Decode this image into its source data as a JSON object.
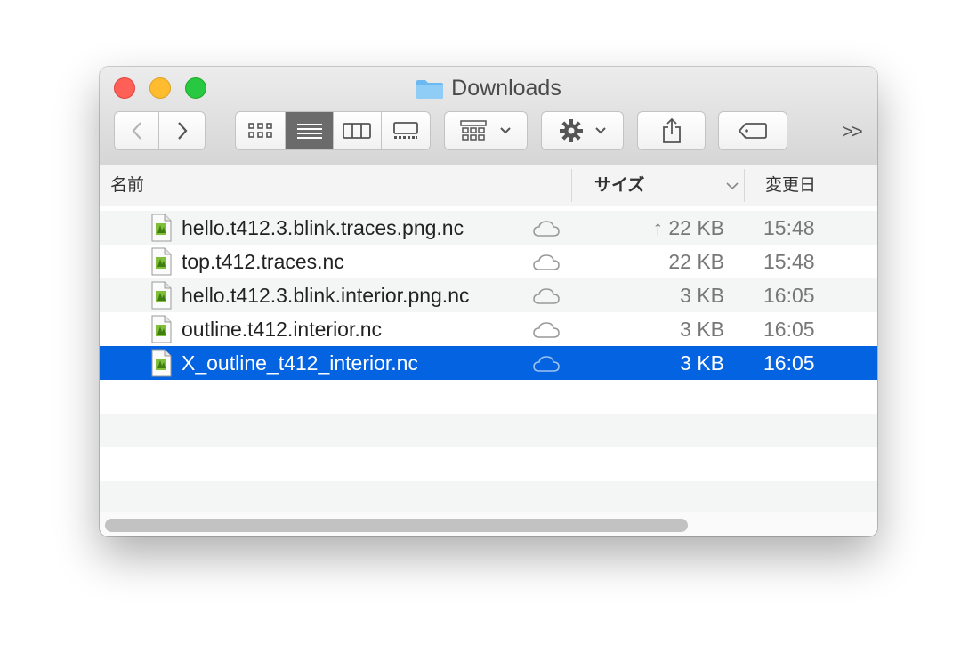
{
  "window": {
    "title": "Downloads"
  },
  "toolbar": {
    "back_icon": "chevron-left-icon",
    "forward_icon": "chevron-right-icon",
    "view_modes": [
      "icon-view",
      "list-view",
      "column-view",
      "gallery-view"
    ],
    "active_view": "list-view",
    "group_icon": "group-by-icon",
    "action_icon": "gear-icon",
    "share_icon": "share-icon",
    "tag_icon": "tag-icon",
    "overflow_label": ">>"
  },
  "columns": {
    "name": "名前",
    "size": "サイズ",
    "date": "変更日"
  },
  "files": [
    {
      "name": "hello.t412.3.blink.traces.png.nc",
      "size": "↑ 22 KB",
      "date": "15:48",
      "cloud": "cloud-icon"
    },
    {
      "name": "top.t412.traces.nc",
      "size": "22 KB",
      "date": "15:48",
      "cloud": "cloud-icon"
    },
    {
      "name": "hello.t412.3.blink.interior.png.nc",
      "size": "3 KB",
      "date": "16:05",
      "cloud": "cloud-icon"
    },
    {
      "name": "outline.t412.interior.nc",
      "size": "3 KB",
      "date": "16:05",
      "cloud": "cloud-icon"
    },
    {
      "name": "X_outline_t412_interior.nc",
      "size": "3 KB",
      "date": "16:05",
      "cloud": "cloud-icon"
    }
  ],
  "selected_index": 4,
  "colors": {
    "selection": "#0463e1",
    "close": "#fe5f57",
    "minimize": "#febc2e",
    "maximize": "#28c840",
    "folder": "#6cb8f0"
  }
}
